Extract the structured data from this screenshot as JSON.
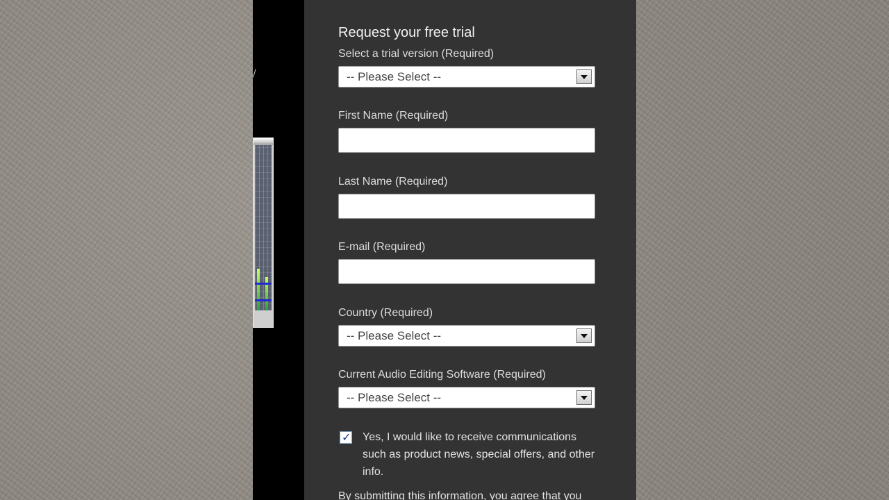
{
  "form": {
    "title": "Request your free trial",
    "trial_version": {
      "label": "Select a trial version (Required)",
      "selected": "-- Please Select --"
    },
    "first_name": {
      "label": "First Name (Required)",
      "value": ""
    },
    "last_name": {
      "label": "Last Name (Required)",
      "value": ""
    },
    "email": {
      "label": "E-mail (Required)",
      "value": ""
    },
    "country": {
      "label": "Country (Required)",
      "selected": "-- Please Select --"
    },
    "audio_software": {
      "label": "Current Audio Editing Software (Required)",
      "selected": "-- Please Select --"
    },
    "newsletter": {
      "checked": true,
      "check_glyph": "✓",
      "label": "Yes, I would like to receive communications such as product news, special offers, and other info."
    },
    "disclaimer": "By submitting this information, you agree that you"
  },
  "colors": {
    "panel": "#333333",
    "page_left": "#000000",
    "text": "#dcdcdc"
  }
}
